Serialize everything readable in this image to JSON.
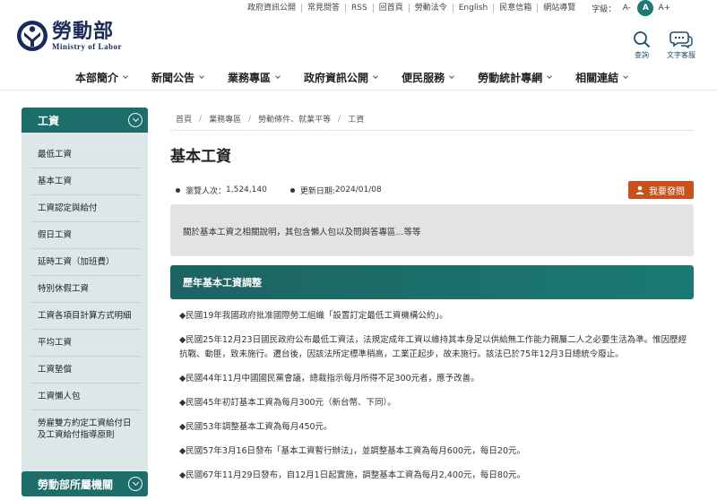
{
  "utility": {
    "links": [
      "政府資訊公開",
      "常見問答",
      "RSS",
      "回首頁",
      "勞動法令",
      "English",
      "民意信箱",
      "網站導覽"
    ],
    "font_size_label": "字級：",
    "font_sizes": [
      "A-",
      "A",
      "A+"
    ],
    "active_font_size": "A"
  },
  "logo": {
    "name_zh": "勞動部",
    "name_en": "Ministry of Labor"
  },
  "header_icons": {
    "search": "查詢",
    "text_service": "文字客服"
  },
  "nav": [
    "本部簡介",
    "新聞公告",
    "業務專區",
    "政府資訊公開",
    "便民服務",
    "勞動統計專網",
    "相關連結"
  ],
  "sidebar": {
    "title": "工資",
    "items": [
      "最低工資",
      "基本工資",
      "工資認定與給付",
      "假日工資",
      "延時工資（加班費）",
      "特別休假工資",
      "工資各項目計算方式明細",
      "平均工資",
      "工資墊償",
      "工資懶人包",
      "勞雇雙方約定工資給付日及工資給付指導原則"
    ],
    "second_title": "勞動部所屬機關"
  },
  "breadcrumb": [
    "首頁",
    "業務專區",
    "勞動條件、就業平等",
    "工資"
  ],
  "page": {
    "title": "基本工資",
    "views_label": "瀏覽人次：",
    "views": "1,524,140",
    "updated_label": "更新日期:",
    "updated": "2024/01/08",
    "feedback": "我要發問",
    "summary": "關於基本工資之相關說明，其包含懶人包以及問與答專區...等等",
    "section_title": "歷年基本工資調整",
    "entries": [
      "◆民國19年我國政府批准國際勞工組織「設置訂定最低工資機構公約」。",
      "◆民國25年12月23日國民政府公布最低工資法，法規定成年工資以維持其本身足以供給無工作能力親屬二人之必要生活為準。惟因歷經抗戰、動匪，致未施行。遷台後，因該法所定標準稍高，工業正起步，故未施行。該法已於75年12月3日總統令廢止。",
      "◆民國44年11月中國國民黨會議，總裁指示每月所得不足300元者，應予改善。",
      "◆民國45年初訂基本工資為每月300元（新台幣、下同）。",
      "◆民國53年調整基本工資為每月450元。",
      "◆民國57年3月16日發布「基本工資暫行辦法」，並調整基本工資為每月600元，每日20元。",
      "◆民國67年11月29日發布，自12月1日起實施，調整基本工資為每月2,400元，每日80元。"
    ]
  }
}
